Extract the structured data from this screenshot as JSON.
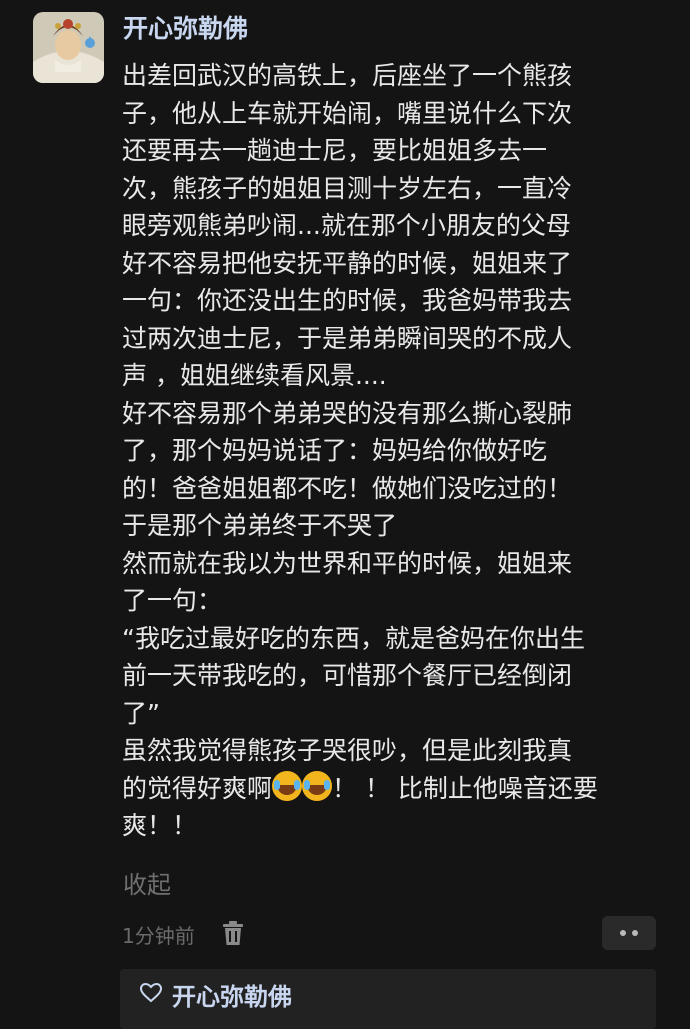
{
  "comment": {
    "author": "开心弥勒佛",
    "lines": [
      "出差回武汉的高铁上，后座坐了一个熊孩",
      "子，他从上车就开始闹，嘴里说什么下次",
      "还要再去一趟迪士尼，要比姐姐多去一",
      "次，熊孩子的姐姐目测十岁左右，一直冷",
      "眼旁观熊弟吵闹...就在那个小朋友的父母",
      "好不容易把他安抚平静的时候，姐姐来了",
      "一句：你还没出生的时候，我爸妈带我去",
      "过两次迪士尼，于是弟弟瞬间哭的不成人",
      "声 ，姐姐继续看风景....",
      "好不容易那个弟弟哭的没有那么撕心裂肺",
      "了，那个妈妈说话了：妈妈给你做好吃",
      "的！爸爸姐姐都不吃！做她们没吃过的！",
      "于是那个弟弟终于不哭了",
      "然而就在我以为世界和平的时候，姐姐来",
      "了一句：",
      "“我吃过最好吃的东西，就是爸妈在你出生",
      "前一天带我吃的，可惜那个餐厅已经倒闭",
      "了”",
      "虽然我觉得熊孩子哭很吵，但是此刻我真"
    ],
    "emoji_line_prefix": "的觉得好爽啊",
    "emoji_line_suffix": "！ ！ 比制止他噪音还要",
    "final_line": "爽！！",
    "emoji_icons": [
      "tears-of-joy-emoji",
      "tears-of-joy-emoji"
    ],
    "collapse_label": "收起",
    "timestamp": "1分钟前"
  },
  "reply_preview": {
    "liked_by": "开心弥勒佛"
  },
  "colors": {
    "background": "#141414",
    "author": "#c9d6f0",
    "text": "#e8e8e8",
    "muted": "#6f6f6f"
  }
}
